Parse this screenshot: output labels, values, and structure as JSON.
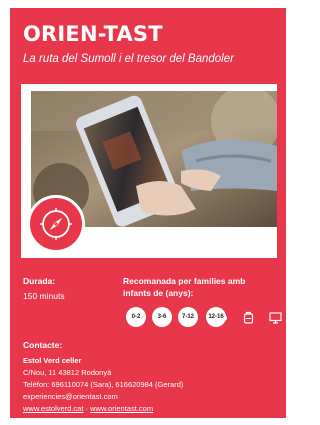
{
  "header": {
    "title": "ORIEN-TAST",
    "subtitle": "La ruta del Sumoll i el tresor del Bandoler"
  },
  "duration": {
    "label": "Durada:",
    "value": "150 minuts"
  },
  "recommended": {
    "label_line1": "Recomanada per famílies amb",
    "label_line2": "infants de (anys):",
    "ages": [
      "0-2",
      "3-6",
      "7-12",
      "12-16"
    ]
  },
  "contact": {
    "label": "Contacte:",
    "name": "Estol Verd celler",
    "address": "C/Nou, 11  43812 Rodonyà",
    "phone": "Telèfon: 696110074 (Sara), 616620984 (Gerard)",
    "email": "experiencies@orientast.com",
    "link1": "www.estolverd.cat",
    "separator": " · ",
    "link2": "www.orientast.com"
  },
  "icons": [
    "compass-icon",
    "wine-tasting-icon",
    "backpack-icon",
    "screen-map-icon"
  ],
  "colors": {
    "brand_red": "#e8364b",
    "white": "#ffffff"
  }
}
